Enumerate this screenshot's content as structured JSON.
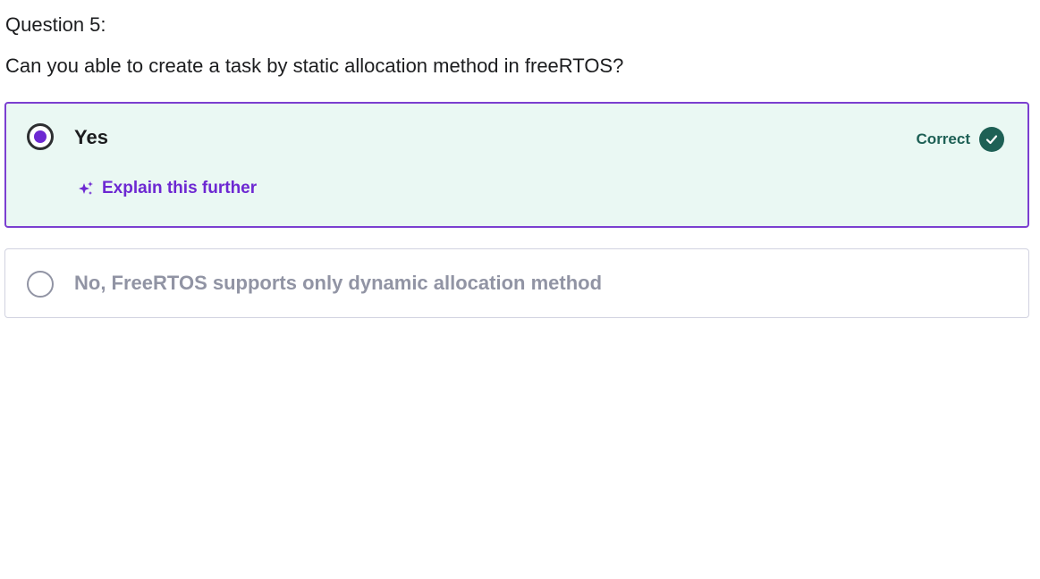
{
  "question": {
    "number_label": "Question 5:",
    "text": "Can you able to create a task by static allocation method in freeRTOS?"
  },
  "options": [
    {
      "label": "Yes",
      "selected": true,
      "status": "Correct",
      "explain_label": "Explain this further"
    },
    {
      "label": "No, FreeRTOS supports only dynamic allocation method",
      "selected": false
    }
  ],
  "icons": {
    "selected_radio": "radio-selected-icon",
    "unselected_radio": "radio-unselected-icon",
    "correct": "check-circle-icon",
    "explain": "sparkle-icon"
  },
  "colors": {
    "accent": "#6d28d2",
    "correct_bg": "#eaf8f3",
    "correct_green": "#1e6055",
    "muted_text": "#9194a4"
  }
}
